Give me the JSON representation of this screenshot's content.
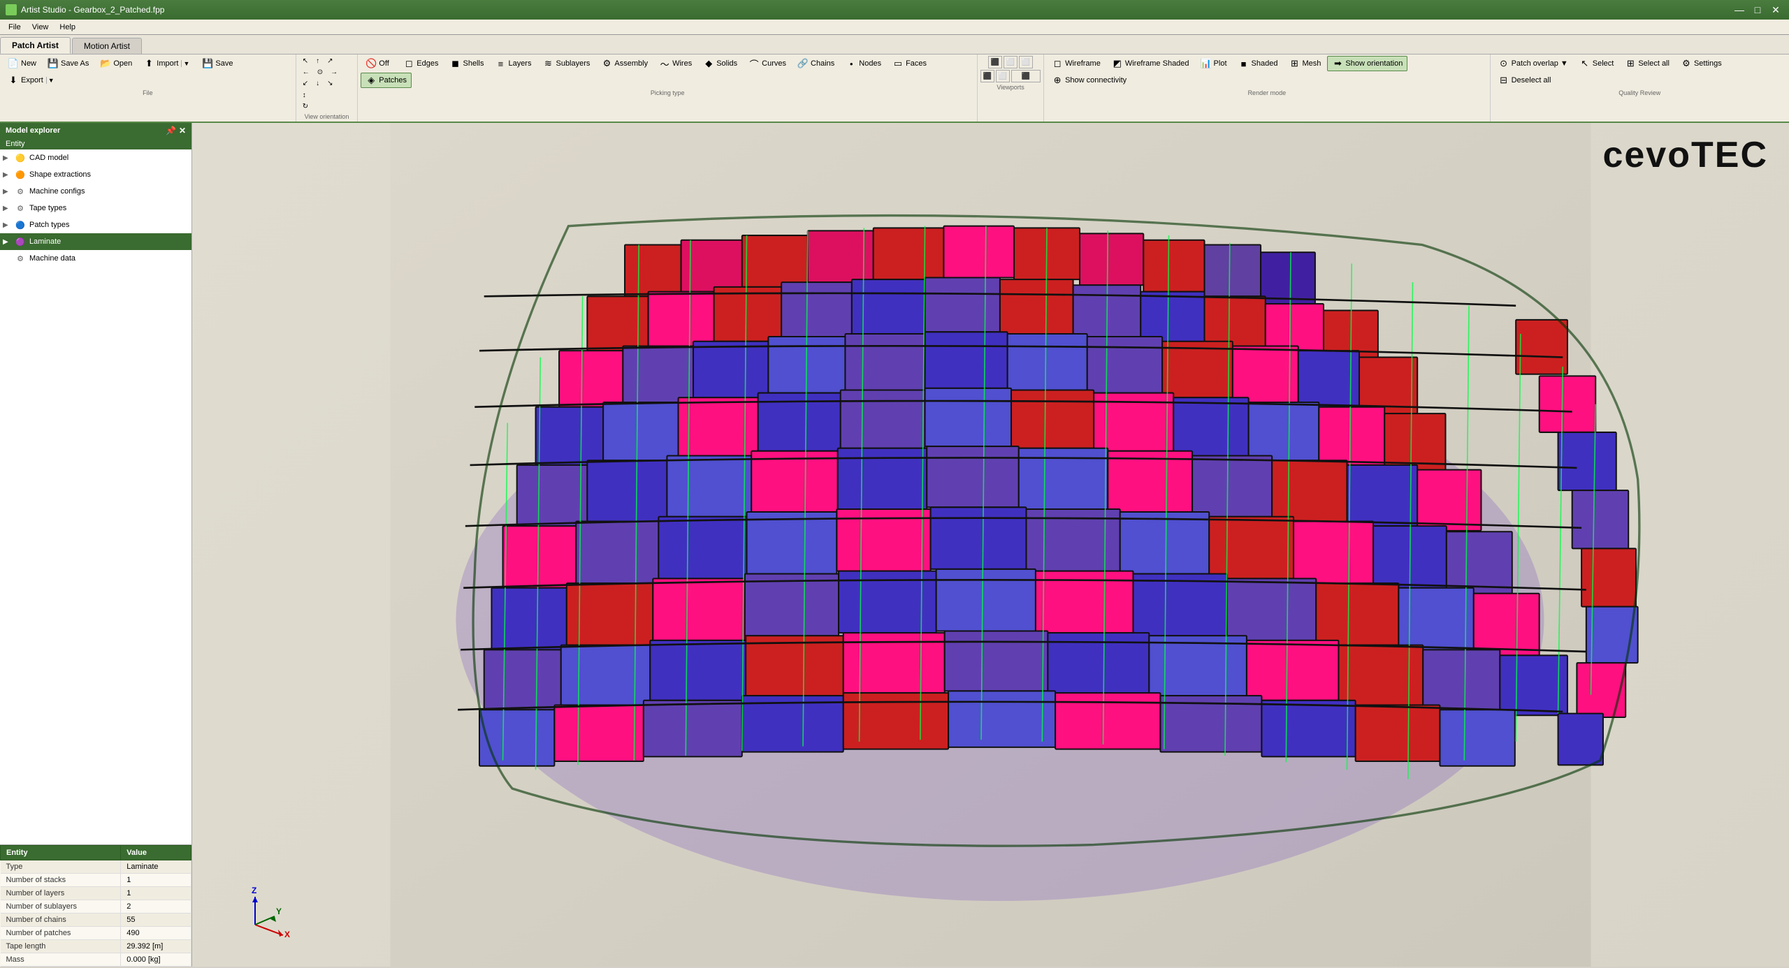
{
  "window": {
    "title": "Artist Studio - Gearbox_2_Patched.fpp",
    "icon": "🎨"
  },
  "window_controls": {
    "minimize": "—",
    "maximize": "□",
    "close": "✕"
  },
  "menu": {
    "items": [
      "File",
      "View",
      "Help"
    ]
  },
  "tabs": [
    {
      "label": "Patch Artist",
      "active": true
    },
    {
      "label": "Motion Artist",
      "active": false
    }
  ],
  "toolbar": {
    "row1": {
      "file_group": {
        "label": "File",
        "buttons": [
          {
            "id": "new",
            "label": "New",
            "icon": "📄"
          },
          {
            "id": "save_as",
            "label": "Save As",
            "icon": "💾"
          }
        ]
      },
      "view_orient_group": {
        "label": "View orientation",
        "buttons": [
          {
            "id": "view1",
            "label": "",
            "icon": "⬆"
          },
          {
            "id": "view2",
            "label": "",
            "icon": "↗"
          },
          {
            "id": "view3",
            "label": "",
            "icon": "➡"
          }
        ]
      },
      "picking_group": {
        "label": "Picking type",
        "buttons": [
          {
            "id": "off",
            "label": "Off",
            "icon": "🚫"
          },
          {
            "id": "edges",
            "label": "Edges",
            "icon": "◻"
          },
          {
            "id": "shells",
            "label": "Shells",
            "icon": "◼"
          },
          {
            "id": "layers",
            "label": "Layers",
            "icon": "≡"
          },
          {
            "id": "sublayers",
            "label": "Sublayers",
            "icon": "≋"
          },
          {
            "id": "assembly",
            "label": "Assembly",
            "icon": "⚙"
          },
          {
            "id": "wires",
            "label": "Wires",
            "icon": "〜"
          },
          {
            "id": "solids",
            "label": "Solids",
            "icon": "◆"
          },
          {
            "id": "curves",
            "label": "Curves",
            "icon": "⌒"
          },
          {
            "id": "chains",
            "label": "Chains",
            "icon": "🔗"
          },
          {
            "id": "nodes",
            "label": "Nodes",
            "icon": "•"
          },
          {
            "id": "faces",
            "label": "Faces",
            "icon": "▭"
          },
          {
            "id": "patches",
            "label": "Patches",
            "icon": "◈",
            "active": true
          }
        ]
      },
      "viewports_group": {
        "label": "Viewports",
        "viewport_icons": [
          "⬛",
          "⬜",
          "⬜",
          "⬛",
          "⬜",
          "⬛",
          "⬜"
        ]
      },
      "render_group": {
        "label": "Render mode",
        "buttons": [
          {
            "id": "wireframe",
            "label": "Wireframe",
            "icon": "◻"
          },
          {
            "id": "wireframe_shaded",
            "label": "Wireframe Shaded",
            "icon": "◼"
          },
          {
            "id": "plot",
            "label": "Plot",
            "icon": "📊"
          },
          {
            "id": "shaded",
            "label": "Shaded",
            "icon": "■"
          },
          {
            "id": "mesh",
            "label": "Mesh",
            "icon": "⊞"
          },
          {
            "id": "show_orientation",
            "label": "Show orientation",
            "icon": "➡",
            "active": true
          }
        ]
      },
      "quality_group": {
        "label": "Quality Review",
        "buttons": [
          {
            "id": "patch_overlap",
            "label": "Patch overlap",
            "icon": "⊙",
            "has_arrow": true
          },
          {
            "id": "select",
            "label": "Select",
            "icon": "↖"
          },
          {
            "id": "select_all",
            "label": "Select all",
            "icon": "⊞"
          },
          {
            "id": "settings",
            "label": "Settings",
            "icon": "⚙"
          },
          {
            "id": "deselect_all",
            "label": "Deselect all",
            "icon": "⊟"
          },
          {
            "id": "show_connectivity",
            "label": "Show connectivity",
            "icon": "⊕"
          }
        ]
      }
    }
  },
  "model_explorer": {
    "title": "Model explorer",
    "section_label": "Entity",
    "tree_items": [
      {
        "id": "cad_model",
        "label": "CAD model",
        "icon": "cad",
        "indent": 1,
        "expanded": true
      },
      {
        "id": "shape_extractions",
        "label": "Shape extractions",
        "icon": "shape",
        "indent": 1,
        "expanded": true
      },
      {
        "id": "machine_configs",
        "label": "Machine configs",
        "icon": "machine",
        "indent": 1,
        "expanded": true
      },
      {
        "id": "tape_types",
        "label": "Tape types",
        "icon": "tape",
        "indent": 1,
        "expanded": true
      },
      {
        "id": "patch_types",
        "label": "Patch types",
        "icon": "patch",
        "indent": 1,
        "expanded": true
      },
      {
        "id": "laminate",
        "label": "Laminate",
        "icon": "laminate",
        "indent": 1,
        "expanded": false,
        "selected": true
      },
      {
        "id": "machine_data",
        "label": "Machine data",
        "icon": "data",
        "indent": 1,
        "expanded": false
      }
    ]
  },
  "properties": {
    "columns": [
      "Entity",
      "Value"
    ],
    "rows": [
      {
        "entity": "Type",
        "value": "Laminate"
      },
      {
        "entity": "Number of stacks",
        "value": "1"
      },
      {
        "entity": "Number of layers",
        "value": "1"
      },
      {
        "entity": "Number of sublayers",
        "value": "2"
      },
      {
        "entity": "Number of chains",
        "value": "55"
      },
      {
        "entity": "Number of patches",
        "value": "490"
      },
      {
        "entity": "Tape length",
        "value": "29.392 [m]"
      },
      {
        "entity": "Mass",
        "value": "0.000 [kg]"
      }
    ]
  },
  "cevotec_logo": "cevoTec",
  "viewport": {
    "background_color": "#ddd8cc"
  }
}
